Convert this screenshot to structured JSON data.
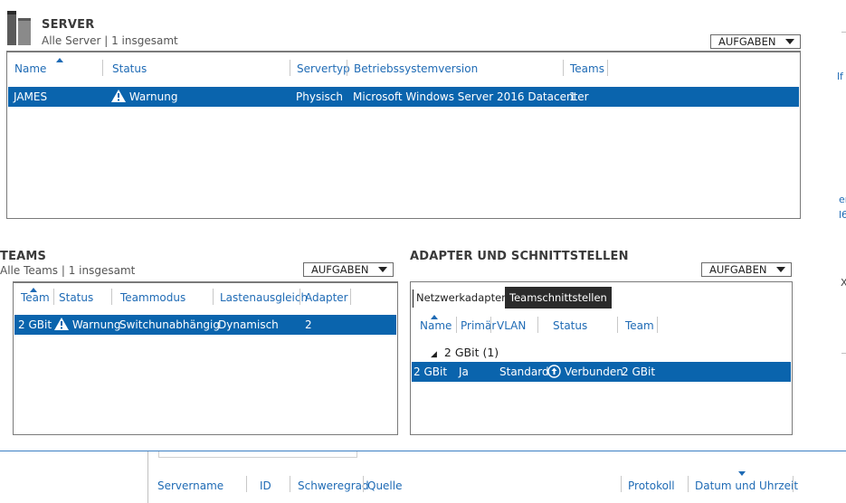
{
  "server": {
    "title": "SERVER",
    "subtitle": "Alle Server | 1 insgesamt",
    "tasks_label": "AUFGABEN",
    "columns": [
      "Name",
      "Status",
      "Servertyp",
      "Betriebssystemversion",
      "Teams"
    ],
    "row": {
      "name": "JAMES",
      "status": "Warnung",
      "type": "Physisch",
      "os": "Microsoft Windows Server 2016 Datacenter",
      "teams": "1"
    }
  },
  "teams": {
    "title": "TEAMS",
    "subtitle": "Alle Teams | 1 insgesamt",
    "tasks_label": "AUFGABEN",
    "columns": [
      "Team",
      "Status",
      "Teammodus",
      "Lastenausgleich",
      "Adapter"
    ],
    "row": {
      "team": "2 GBit",
      "status": "Warnung",
      "mode": "Switchunabhängig",
      "balance": "Dynamisch",
      "adapter": "2"
    }
  },
  "adapters": {
    "title": "ADAPTER UND SCHNITTSTELLEN",
    "tasks_label": "AUFGABEN",
    "tabs": [
      "Netzwerkadapter",
      "Teamschnittstellen"
    ],
    "columns": [
      "Name",
      "Primär",
      "VLAN",
      "Status",
      "Team"
    ],
    "group": "2 GBit (1)",
    "row": {
      "name": "2 GBit",
      "primary": "Ja",
      "vlan": "Standard",
      "status": "Verbunden",
      "team": "2 GBit"
    }
  },
  "events": {
    "columns": [
      "Servername",
      "ID",
      "Schweregrad",
      "Quelle",
      "Protokoll",
      "Datum und Uhrzeit"
    ]
  },
  "right_fragments": {
    "a": "lf",
    "b": "er",
    "c": "l6",
    "d": "X"
  },
  "colors": {
    "selection": "#0a64ad",
    "link": "#1f6bb5",
    "accent_line": "#3c7fc4"
  }
}
